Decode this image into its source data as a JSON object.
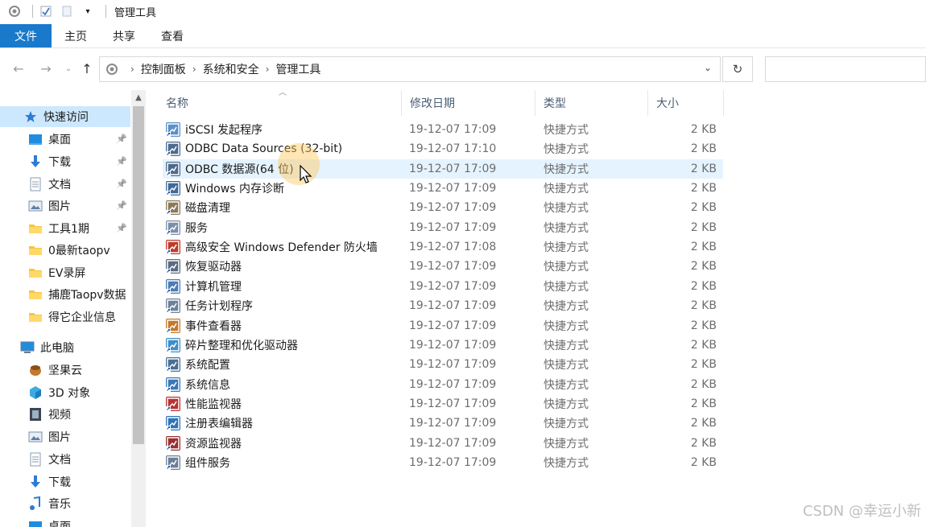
{
  "titlebar": {
    "title": "管理工具"
  },
  "ribbon": {
    "tabs": [
      "文件",
      "主页",
      "共享",
      "查看"
    ]
  },
  "address": {
    "breadcrumbs": [
      "控制面板",
      "系统和安全",
      "管理工具"
    ]
  },
  "nav": {
    "items": [
      {
        "label": "快速访问",
        "icon": "star-icon",
        "pinned": false
      },
      {
        "label": "桌面",
        "icon": "desktop-icon",
        "pinned": true
      },
      {
        "label": "下载",
        "icon": "download-icon",
        "pinned": true
      },
      {
        "label": "文档",
        "icon": "document-icon",
        "pinned": true
      },
      {
        "label": "图片",
        "icon": "picture-icon",
        "pinned": true
      },
      {
        "label": "工具1期",
        "icon": "folder-icon",
        "pinned": true
      },
      {
        "label": "0最新taopv",
        "icon": "folder-icon",
        "pinned": false
      },
      {
        "label": "EV录屏",
        "icon": "folder-icon",
        "pinned": false
      },
      {
        "label": "捕鹿Taopv数据",
        "icon": "folder-icon",
        "pinned": false
      },
      {
        "label": "得它企业信息",
        "icon": "folder-icon",
        "pinned": false
      },
      {
        "label": "此电脑",
        "icon": "computer-icon",
        "pinned": false
      },
      {
        "label": "坚果云",
        "icon": "nut-icon",
        "pinned": false
      },
      {
        "label": "3D 对象",
        "icon": "cube-icon",
        "pinned": false
      },
      {
        "label": "视频",
        "icon": "video-icon",
        "pinned": false
      },
      {
        "label": "图片",
        "icon": "picture-icon",
        "pinned": false
      },
      {
        "label": "文档",
        "icon": "document-icon",
        "pinned": false
      },
      {
        "label": "下载",
        "icon": "download-icon",
        "pinned": false
      },
      {
        "label": "音乐",
        "icon": "music-icon",
        "pinned": false
      },
      {
        "label": "桌面",
        "icon": "desktop-icon",
        "pinned": false
      }
    ]
  },
  "columns": {
    "name": "名称",
    "date": "修改日期",
    "type": "类型",
    "size": "大小"
  },
  "files": [
    {
      "name": "iSCSI 发起程序",
      "date": "19-12-07 17:09",
      "type": "快捷方式",
      "size": "2 KB",
      "icon": "iscsi-icon"
    },
    {
      "name": "ODBC Data Sources (32-bit)",
      "date": "19-12-07 17:10",
      "type": "快捷方式",
      "size": "2 KB",
      "icon": "odbc-icon"
    },
    {
      "name": "ODBC 数据源(64 位)",
      "date": "19-12-07 17:09",
      "type": "快捷方式",
      "size": "2 KB",
      "icon": "odbc-icon"
    },
    {
      "name": "Windows 内存诊断",
      "date": "19-12-07 17:09",
      "type": "快捷方式",
      "size": "2 KB",
      "icon": "memory-diagnostic-icon"
    },
    {
      "name": "磁盘清理",
      "date": "19-12-07 17:09",
      "type": "快捷方式",
      "size": "2 KB",
      "icon": "disk-cleanup-icon"
    },
    {
      "name": "服务",
      "date": "19-12-07 17:09",
      "type": "快捷方式",
      "size": "2 KB",
      "icon": "services-icon"
    },
    {
      "name": "高级安全 Windows Defender 防火墙",
      "date": "19-12-07 17:08",
      "type": "快捷方式",
      "size": "2 KB",
      "icon": "firewall-icon"
    },
    {
      "name": "恢复驱动器",
      "date": "19-12-07 17:09",
      "type": "快捷方式",
      "size": "2 KB",
      "icon": "recovery-drive-icon"
    },
    {
      "name": "计算机管理",
      "date": "19-12-07 17:09",
      "type": "快捷方式",
      "size": "2 KB",
      "icon": "computer-management-icon"
    },
    {
      "name": "任务计划程序",
      "date": "19-12-07 17:09",
      "type": "快捷方式",
      "size": "2 KB",
      "icon": "task-scheduler-icon"
    },
    {
      "name": "事件查看器",
      "date": "19-12-07 17:09",
      "type": "快捷方式",
      "size": "2 KB",
      "icon": "event-viewer-icon"
    },
    {
      "name": "碎片整理和优化驱动器",
      "date": "19-12-07 17:09",
      "type": "快捷方式",
      "size": "2 KB",
      "icon": "defrag-icon"
    },
    {
      "name": "系统配置",
      "date": "19-12-07 17:09",
      "type": "快捷方式",
      "size": "2 KB",
      "icon": "system-config-icon"
    },
    {
      "name": "系统信息",
      "date": "19-12-07 17:09",
      "type": "快捷方式",
      "size": "2 KB",
      "icon": "system-info-icon"
    },
    {
      "name": "性能监视器",
      "date": "19-12-07 17:09",
      "type": "快捷方式",
      "size": "2 KB",
      "icon": "performance-monitor-icon"
    },
    {
      "name": "注册表编辑器",
      "date": "19-12-07 17:09",
      "type": "快捷方式",
      "size": "2 KB",
      "icon": "registry-editor-icon"
    },
    {
      "name": "资源监视器",
      "date": "19-12-07 17:09",
      "type": "快捷方式",
      "size": "2 KB",
      "icon": "resource-monitor-icon"
    },
    {
      "name": "组件服务",
      "date": "19-12-07 17:09",
      "type": "快捷方式",
      "size": "2 KB",
      "icon": "component-services-icon"
    }
  ],
  "hovered_row": 2,
  "watermark": "CSDN @幸运小新",
  "colors": {
    "accent": "#1979ca",
    "selected": "#cce8ff",
    "hover": "#e5f3ff",
    "header_text": "#4b5d75"
  }
}
